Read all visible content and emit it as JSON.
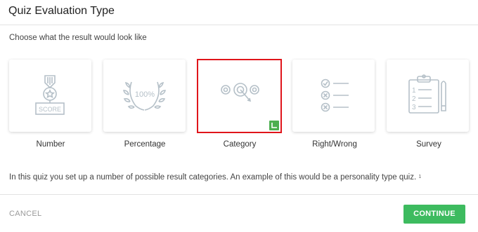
{
  "header": {
    "title": "Quiz Evaluation Type"
  },
  "subtitle": "Choose what the result would look like",
  "types": [
    {
      "label": "Number",
      "icon": "score-medal-icon",
      "icon_text": "SCORE",
      "selected": false
    },
    {
      "label": "Percentage",
      "icon": "laurel-percent-icon",
      "icon_text": "100%",
      "selected": false
    },
    {
      "label": "Category",
      "icon": "target-arrow-icon",
      "selected": true
    },
    {
      "label": "Right/Wrong",
      "icon": "checklist-icon",
      "selected": false
    },
    {
      "label": "Survey",
      "icon": "clipboard-survey-icon",
      "icon_text_items": [
        "1",
        "2",
        "3"
      ],
      "selected": false
    }
  ],
  "description": "In this quiz you set up a number of possible result categories. An example of this would be a personality type quiz.",
  "description_fraction": "1",
  "footer": {
    "cancel_label": "CANCEL",
    "continue_label": "CONTINUE"
  },
  "colors": {
    "icon": "#b5c0c8",
    "selected_border": "#e0151b",
    "continue_bg": "#3dbb5f",
    "check_bg": "#4caf50"
  }
}
